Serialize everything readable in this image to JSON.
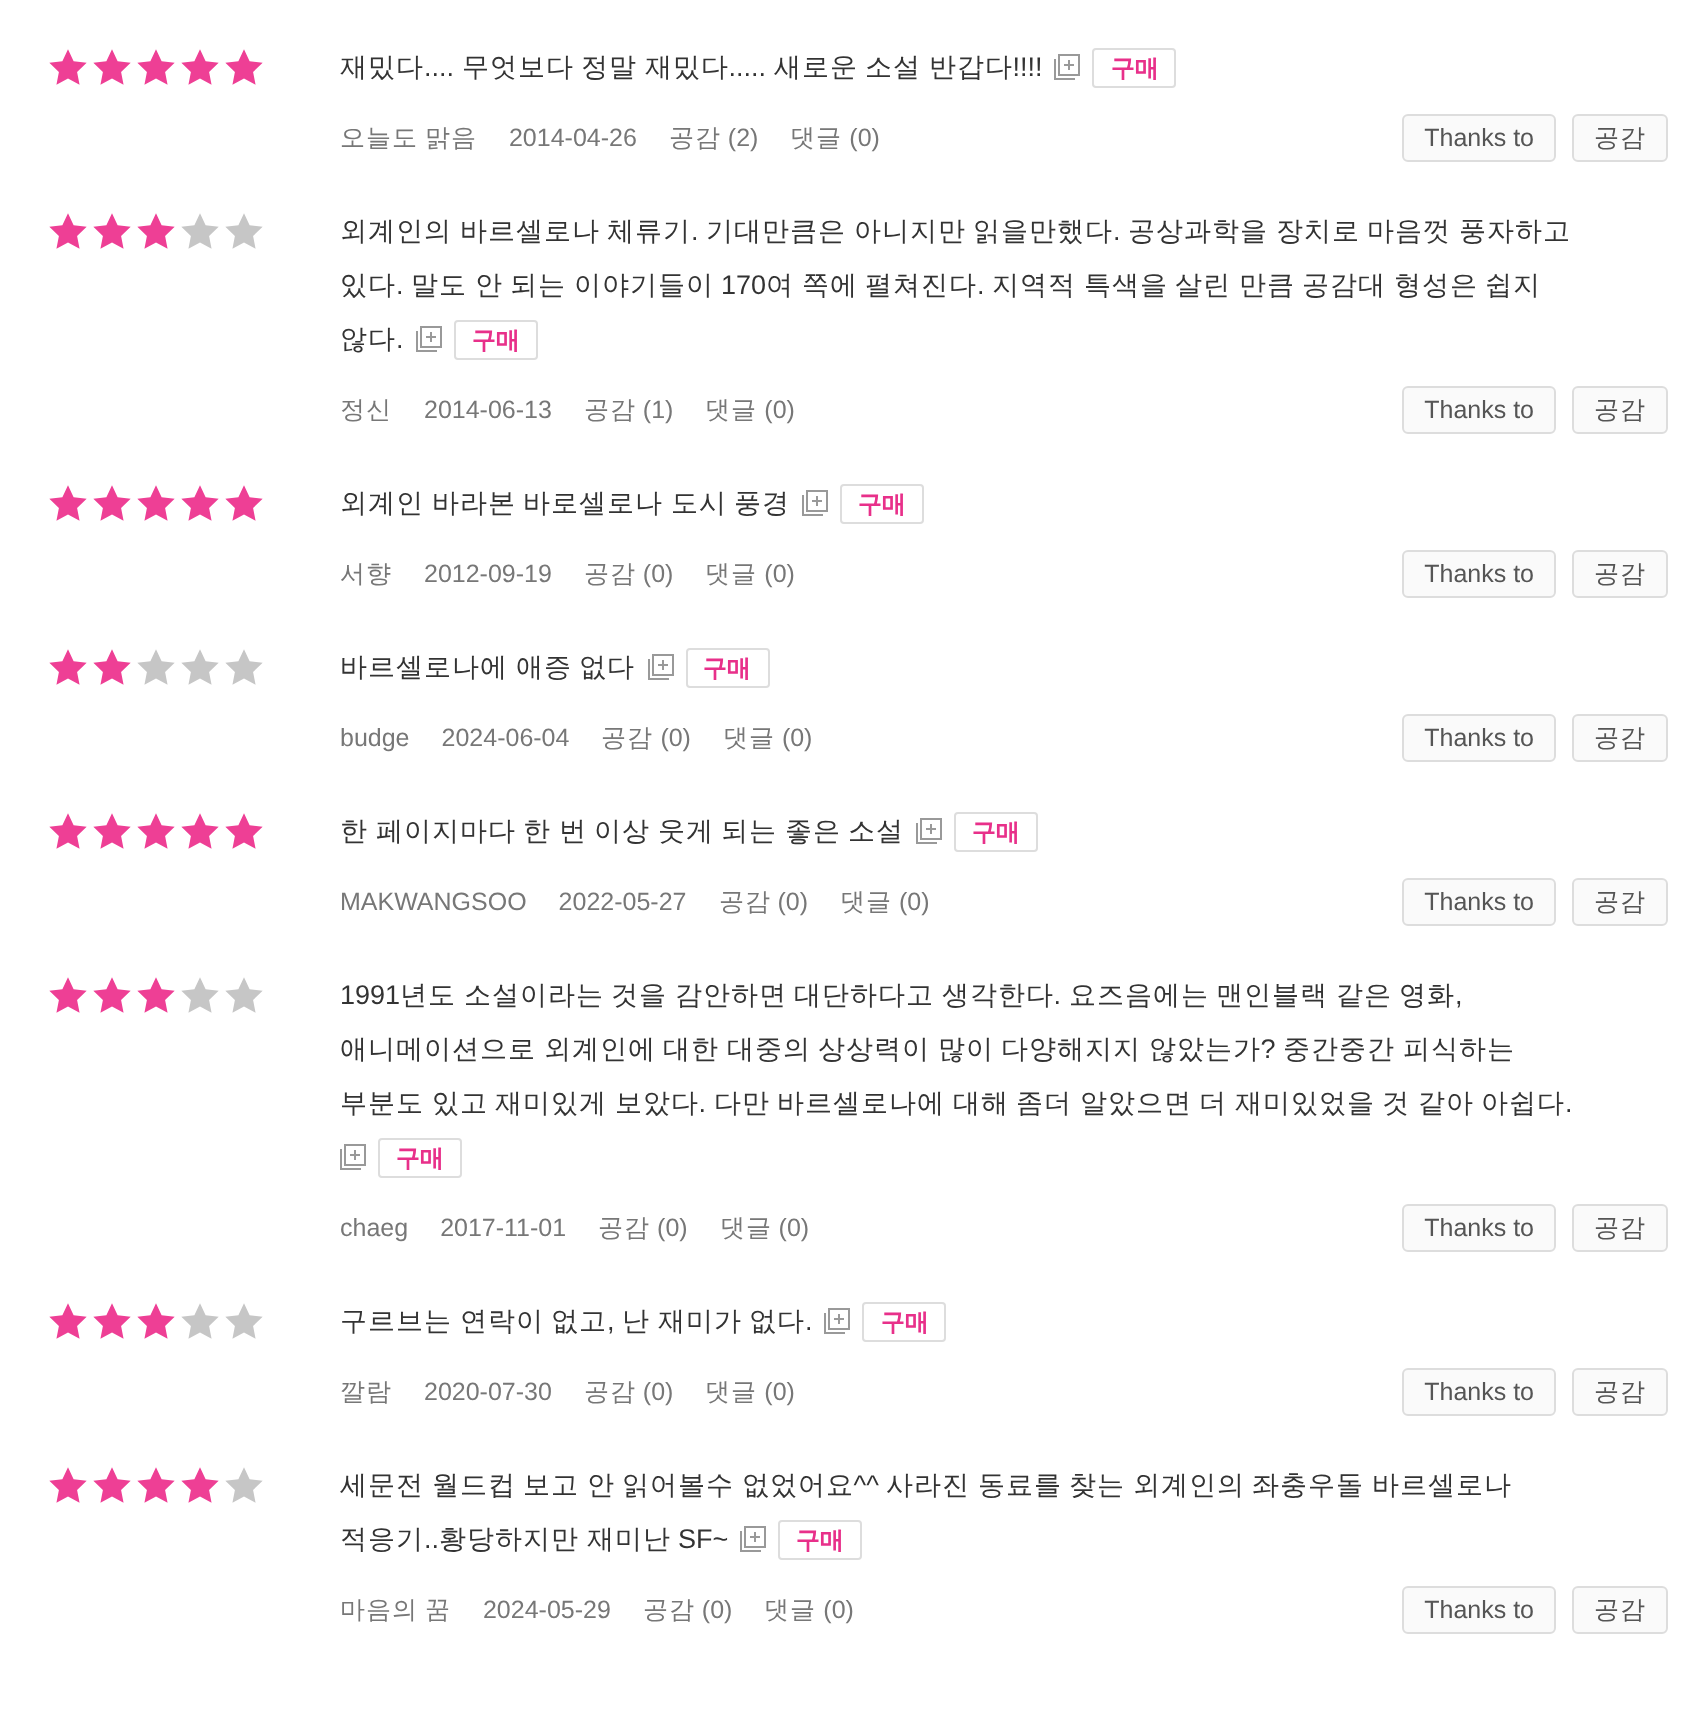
{
  "reviews": [
    {
      "stars": 5,
      "lines": [
        "재밌다.... 무엇보다 정말 재밌다..... 새로운 소설 반갑다!!!!"
      ],
      "badge": "구매",
      "author": "오늘도 맑음",
      "date": "2014-04-26",
      "likes": "공감 (2)",
      "comments": "댓글 (0)",
      "buttons": [
        "Thanks to",
        "공감"
      ]
    },
    {
      "stars": 3,
      "lines": [
        "외계인의 바르셀로나 체류기. 기대만큼은 아니지만 읽을만했다. 공상과학을 장치로 마음껏 풍자하고",
        "있다. 말도 안 되는 이야기들이 170여 쪽에 펼쳐진다. 지역적 특색을 살린 만큼 공감대 형성은 쉽지",
        "않다."
      ],
      "badge": "구매",
      "author": "정신",
      "date": "2014-06-13",
      "likes": "공감 (1)",
      "comments": "댓글 (0)",
      "buttons": [
        "Thanks to",
        "공감"
      ]
    },
    {
      "stars": 5,
      "lines": [
        "외계인 바라본 바로셀로나 도시 풍경"
      ],
      "badge": "구매",
      "author": "서향",
      "date": "2012-09-19",
      "likes": "공감 (0)",
      "comments": "댓글 (0)",
      "buttons": [
        "Thanks to",
        "공감"
      ]
    },
    {
      "stars": 2,
      "lines": [
        "바르셀로나에 애증 없다"
      ],
      "badge": "구매",
      "author": "budge",
      "date": "2024-06-04",
      "likes": "공감 (0)",
      "comments": "댓글 (0)",
      "buttons": [
        "Thanks to",
        "공감"
      ]
    },
    {
      "stars": 5,
      "lines": [
        "한 페이지마다 한 번 이상 웃게 되는 좋은 소설"
      ],
      "badge": "구매",
      "author": "MAKWANGSOO",
      "date": "2022-05-27",
      "likes": "공감 (0)",
      "comments": "댓글 (0)",
      "buttons": [
        "Thanks to",
        "공감"
      ]
    },
    {
      "stars": 3,
      "lines": [
        "1991년도 소설이라는 것을 감안하면 대단하다고 생각한다. 요즈음에는 맨인블랙 같은 영화,",
        "애니메이션으로 외계인에 대한 대중의 상상력이 많이 다양해지지 않았는가? 중간중간 피식하는",
        "부분도 있고 재미있게 보았다. 다만 바르셀로나에 대해 좀더 알았으면 더 재미있었을 것 같아 아쉽다."
      ],
      "badge_wraps": true,
      "badge": "구매",
      "author": "chaeg",
      "date": "2017-11-01",
      "likes": "공감 (0)",
      "comments": "댓글 (0)",
      "buttons": [
        "Thanks to",
        "공감"
      ]
    },
    {
      "stars": 3,
      "lines": [
        "구르브는 연락이 없고, 난 재미가 없다."
      ],
      "badge": "구매",
      "author": "깔람",
      "date": "2020-07-30",
      "likes": "공감 (0)",
      "comments": "댓글 (0)",
      "buttons": [
        "Thanks to",
        "공감"
      ]
    },
    {
      "stars": 4,
      "lines": [
        "세문전 월드컵 보고 안 읽어볼수 없었어요^^ 사라진 동료를 찾는 외계인의 좌충우돌 바르셀로나",
        "적응기..황당하지만 재미난 SF~"
      ],
      "badge": "구매",
      "author": "마음의 꿈",
      "date": "2024-05-29",
      "likes": "공감 (0)",
      "comments": "댓글 (0)",
      "buttons": [
        "Thanks to",
        "공감"
      ]
    }
  ]
}
